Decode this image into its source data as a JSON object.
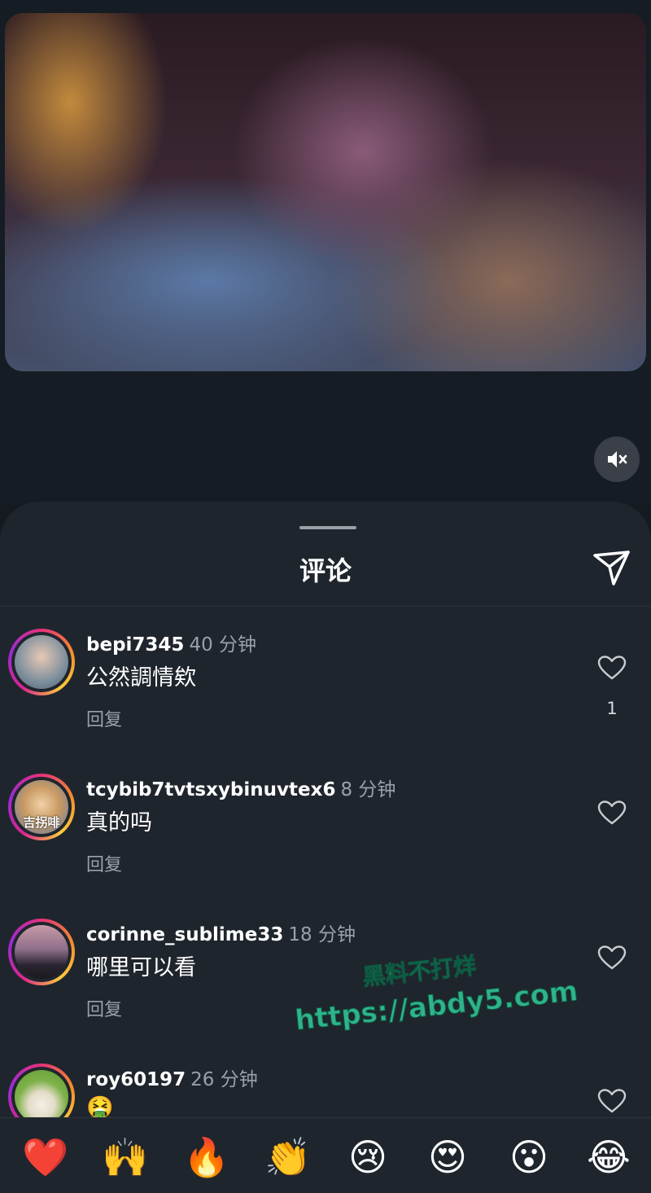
{
  "sheet": {
    "title": "评论"
  },
  "comments": [
    {
      "username": "bepi7345",
      "time": "40 分钟",
      "text": "公然調情欸",
      "reply": "回复",
      "likes": "1",
      "avatar_text": ""
    },
    {
      "username": "tcybib7tvtsxybinuvtex6",
      "time": "8 分钟",
      "text": "真的吗",
      "reply": "回复",
      "likes": "",
      "avatar_text": "吉拐啡"
    },
    {
      "username": "corinne_sublime33",
      "time": "18 分钟",
      "text": "哪里可以看",
      "reply": "回复",
      "likes": "",
      "avatar_text": ""
    },
    {
      "username": "roy60197",
      "time": "26 分钟",
      "text": "🤮",
      "reply": "",
      "likes": "",
      "avatar_text": ""
    }
  ],
  "emoji_bar": [
    "❤️",
    "🙌",
    "🔥",
    "👏",
    "😢",
    "😍",
    "😮",
    "😂"
  ],
  "watermark": {
    "line1": "黑料不打烊",
    "line2": "https://abdy5.com"
  },
  "colors": {
    "background": "#151a20",
    "sheet": "#1f252d",
    "muted_text": "#9aa0a8",
    "watermark": "#2fb38a"
  }
}
